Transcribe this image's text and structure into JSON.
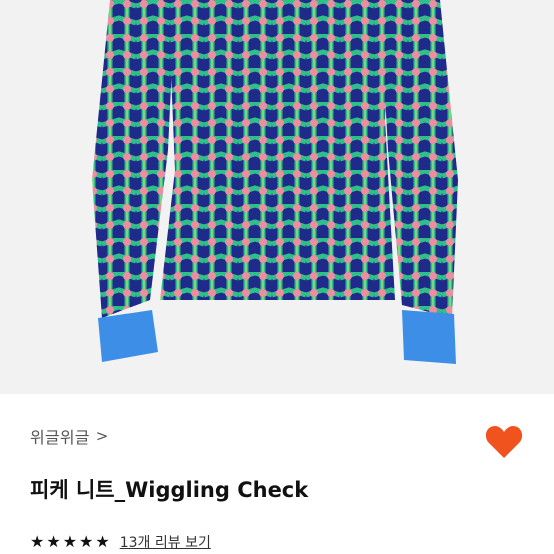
{
  "product": {
    "image_alt": "sweater product photo",
    "brand": "위글위글",
    "brand_chevron": ">",
    "title": "피케 니트_Wiggling Check",
    "rating": 5,
    "stars": [
      "★",
      "★",
      "★",
      "★",
      "★"
    ],
    "review_link": "13개 리뷰 보기"
  },
  "colors": {
    "navy": "#1f2a8a",
    "green": "#2fc08a",
    "pink": "#ee8ca0",
    "cuff_blue": "#3c8ee6",
    "heart_orange": "#f0531e"
  }
}
